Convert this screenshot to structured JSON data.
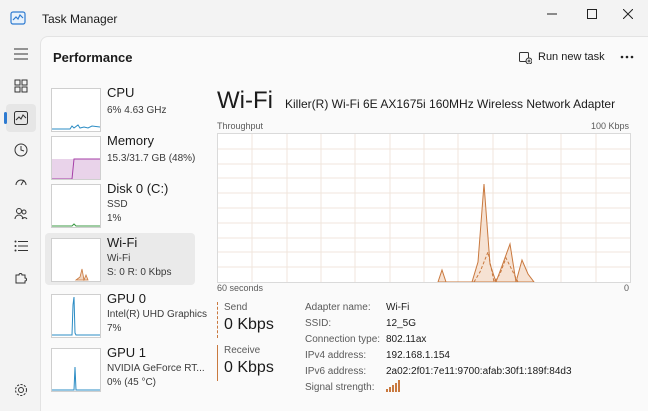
{
  "window": {
    "title": "Task Manager"
  },
  "page": {
    "title": "Performance"
  },
  "toolbar": {
    "run_new_task": "Run new task"
  },
  "colors": {
    "accent": "#2e7bd1",
    "wifi": "#c9793f",
    "memory": "#a53ea7",
    "disk": "#3c9a45",
    "gpu": "#2b8cc4"
  },
  "sidebar": [
    {
      "name": "CPU",
      "sub1": "6%  4.63 GHz",
      "sub2": ""
    },
    {
      "name": "Memory",
      "sub1": "15.3/31.7 GB (48%)",
      "sub2": ""
    },
    {
      "name": "Disk 0 (C:)",
      "sub1": "SSD",
      "sub2": "1%"
    },
    {
      "name": "Wi-Fi",
      "sub1": "Wi-Fi",
      "sub2": "S: 0  R: 0 Kbps"
    },
    {
      "name": "GPU 0",
      "sub1": "Intel(R) UHD Graphics",
      "sub2": "7%"
    },
    {
      "name": "GPU 1",
      "sub1": "NVIDIA GeForce RT...",
      "sub2": "0%  (45 °C)"
    }
  ],
  "detail": {
    "title": "Wi-Fi",
    "adapter": "Killer(R) Wi-Fi 6E AX1675i 160MHz Wireless Network Adapter",
    "graph_label": "Throughput",
    "graph_max": "100 Kbps",
    "graph_time": "60 seconds",
    "graph_min": "0",
    "send_label": "Send",
    "send_value": "0 Kbps",
    "receive_label": "Receive",
    "receive_value": "0 Kbps",
    "props": [
      {
        "label": "Adapter name:",
        "value": "Wi-Fi"
      },
      {
        "label": "SSID:",
        "value": "12_5G"
      },
      {
        "label": "Connection type:",
        "value": "802.11ax"
      },
      {
        "label": "IPv4 address:",
        "value": "192.168.1.154"
      },
      {
        "label": "IPv6 address:",
        "value": "2a02:2f01:7e11:9700:afab:30f1:189f:84d3"
      },
      {
        "label": "Signal strength:",
        "value": ""
      }
    ],
    "signal_bars": 5
  }
}
